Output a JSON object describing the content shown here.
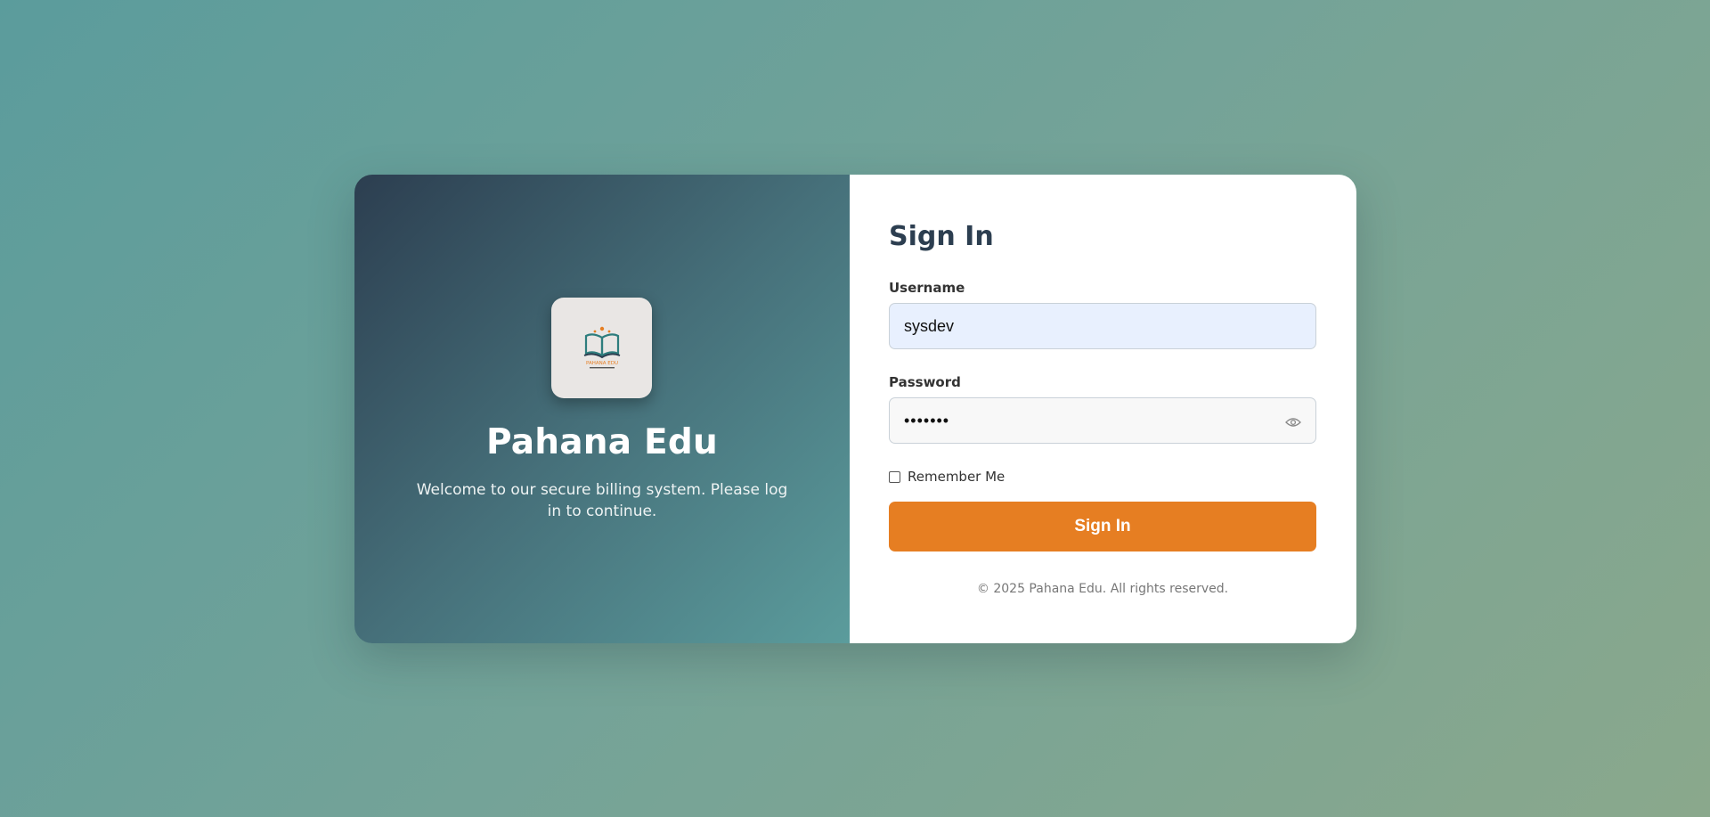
{
  "brand": {
    "logo_icon": "open-book-logo-icon",
    "logo_text": "PAHANA EDU",
    "title": "Pahana Edu",
    "subtitle": "Welcome to our secure billing system. Please log in to continue."
  },
  "form": {
    "title": "Sign In",
    "username_label": "Username",
    "username_value": "sysdev",
    "password_label": "Password",
    "password_value": "•••••••",
    "password_toggle_icon": "eye-icon",
    "remember_label": "Remember Me",
    "remember_checked": false,
    "submit_label": "Sign In"
  },
  "footer": {
    "copyright": "© 2025 Pahana Edu. All rights reserved."
  },
  "colors": {
    "accent": "#e67e22",
    "heading": "#2c3e50",
    "panel_gradient_start": "#2c3e50",
    "panel_gradient_end": "#5b9c9c"
  }
}
